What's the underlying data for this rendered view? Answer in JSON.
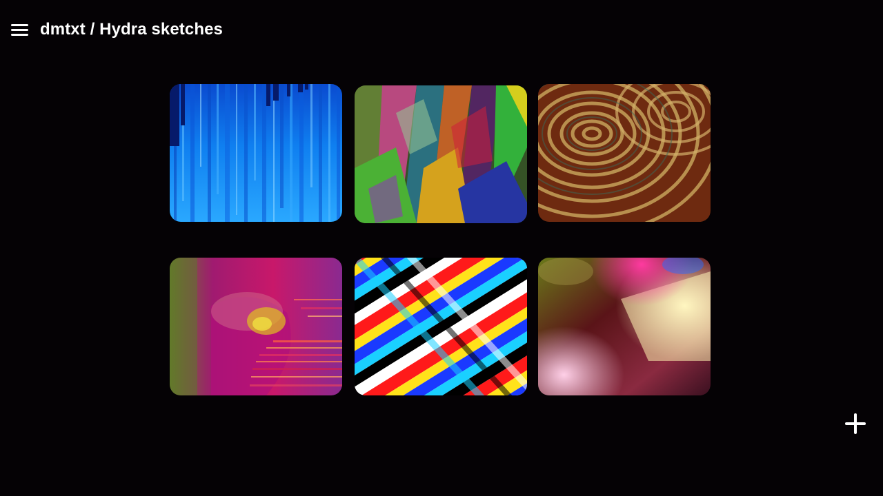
{
  "header": {
    "title": "dmtxt / Hydra sketches",
    "menu_icon": "hamburger-menu-icon"
  },
  "sketches": [
    {
      "id": "sketch-1",
      "palette": [
        "#0a58d6",
        "#1e90ff",
        "#0a2a8a"
      ]
    },
    {
      "id": "sketch-2",
      "palette": [
        "#d0307e",
        "#2fbf3a",
        "#e0a020"
      ]
    },
    {
      "id": "sketch-3",
      "palette": [
        "#7a2e12",
        "#c8a458",
        "#3d2410"
      ]
    },
    {
      "id": "sketch-4",
      "palette": [
        "#a0186a",
        "#d42a3a",
        "#7a8a2a"
      ]
    },
    {
      "id": "sketch-5",
      "palette": [
        "#ff1a1a",
        "#1aa0ff",
        "#ffe21a"
      ]
    },
    {
      "id": "sketch-6",
      "palette": [
        "#5a1418",
        "#ffe0a0",
        "#ff4aa0"
      ]
    }
  ],
  "actions": {
    "add_icon": "plus-icon"
  }
}
